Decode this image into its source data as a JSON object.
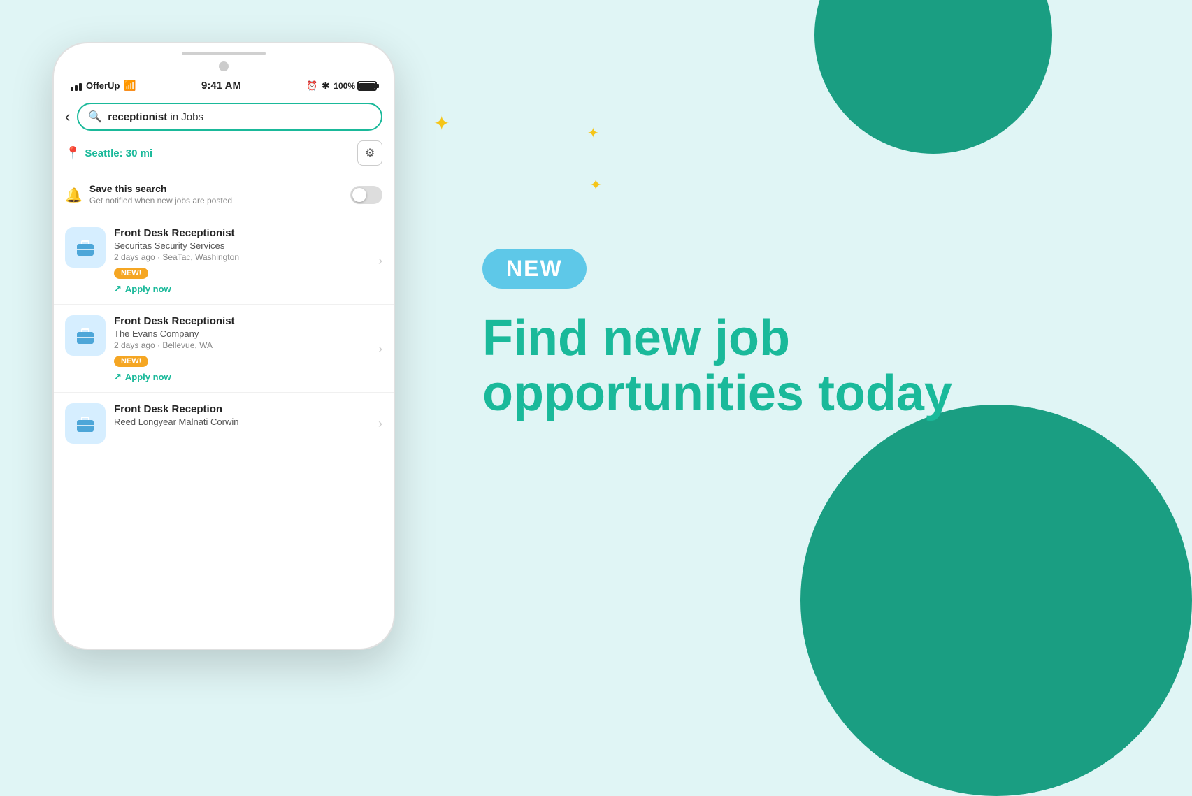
{
  "background_color": "#d8f4f0",
  "status_bar": {
    "carrier": "OfferUp",
    "time": "9:41 AM",
    "battery_percent": "100%"
  },
  "search": {
    "query_bold": "receptionist",
    "query_rest": " in Jobs",
    "placeholder": "receptionist in Jobs"
  },
  "location": {
    "text": "Seattle: 30 mi"
  },
  "save_search": {
    "label": "Save this search",
    "sublabel": "Get notified when new jobs are posted"
  },
  "jobs": [
    {
      "title": "Front Desk Receptionist",
      "company": "Securitas Security Services",
      "meta": "2 days ago · SeaTac, Washington",
      "badge": "NEW!",
      "apply_label": "Apply now"
    },
    {
      "title": "Front Desk Receptionist",
      "company": "The Evans Company",
      "meta": "2 days ago · Bellevue, WA",
      "badge": "NEW!",
      "apply_label": "Apply now"
    },
    {
      "title": "Front Desk Reception",
      "company": "Reed Longyear Malnati Corwin",
      "meta": "",
      "badge": "",
      "apply_label": ""
    }
  ],
  "right_panel": {
    "new_label": "NEW",
    "hero_line1": "Find new job",
    "hero_line2": "opportunities today"
  },
  "sparkles": [
    "+",
    "+",
    "+"
  ]
}
